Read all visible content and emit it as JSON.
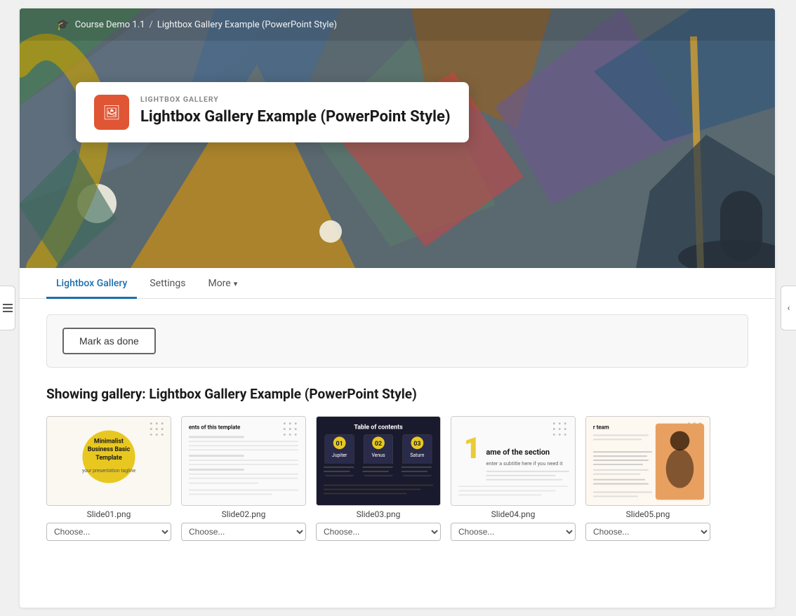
{
  "breadcrumb": {
    "icon": "🎓",
    "course_name": "Course Demo 1.1",
    "separator": "/",
    "page_name": "Lightbox Gallery Example (PowerPoint Style)"
  },
  "title_card": {
    "category_label": "LIGHTBOX GALLERY",
    "title": "Lightbox Gallery Example (PowerPoint Style)"
  },
  "tabs": [
    {
      "id": "lightbox-gallery",
      "label": "Lightbox Gallery",
      "active": true
    },
    {
      "id": "settings",
      "label": "Settings",
      "active": false
    },
    {
      "id": "more",
      "label": "More",
      "active": false,
      "has_dropdown": true
    }
  ],
  "actions": {
    "mark_done_label": "Mark as done"
  },
  "gallery": {
    "heading": "Showing gallery: Lightbox Gallery Example (PowerPoint Style)",
    "items": [
      {
        "id": 1,
        "filename": "Slide01.png",
        "select_default": "Choose..."
      },
      {
        "id": 2,
        "filename": "Slide02.png",
        "select_default": "Choose..."
      },
      {
        "id": 3,
        "filename": "Slide03.png",
        "select_default": "Choose..."
      },
      {
        "id": 4,
        "filename": "Slide04.png",
        "select_default": "Choose..."
      },
      {
        "id": 5,
        "filename": "Slide05.png",
        "select_default": "Choose..."
      }
    ]
  },
  "colors": {
    "active_tab": "#1a6faf",
    "icon_bg": "#e05533",
    "hero_bg": "#556070"
  }
}
